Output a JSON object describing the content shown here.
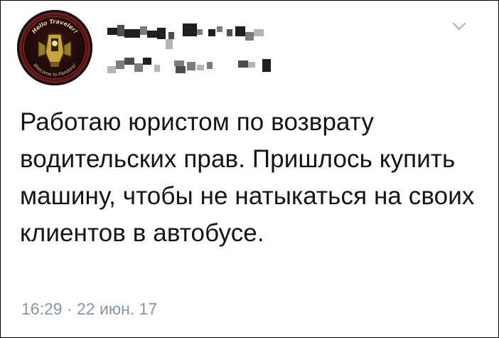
{
  "tweet": {
    "text": "Работаю юристом по возврату водительских прав. Пришлось купить машину, чтобы не натыкаться на своих клиентов в автобусе.",
    "timestamp": "16:29 · 22 июн. 17"
  },
  "avatar": {
    "top_text": "Hello Traveler!",
    "bottom_text": "Welcome to Pandora!"
  },
  "colors": {
    "text": "#141414",
    "timestamp": "#8a96a3",
    "avatar_ring": "#6b1b1b",
    "chevron": "#a8b4c0"
  },
  "icons": {
    "menu": "chevron-down-icon"
  }
}
